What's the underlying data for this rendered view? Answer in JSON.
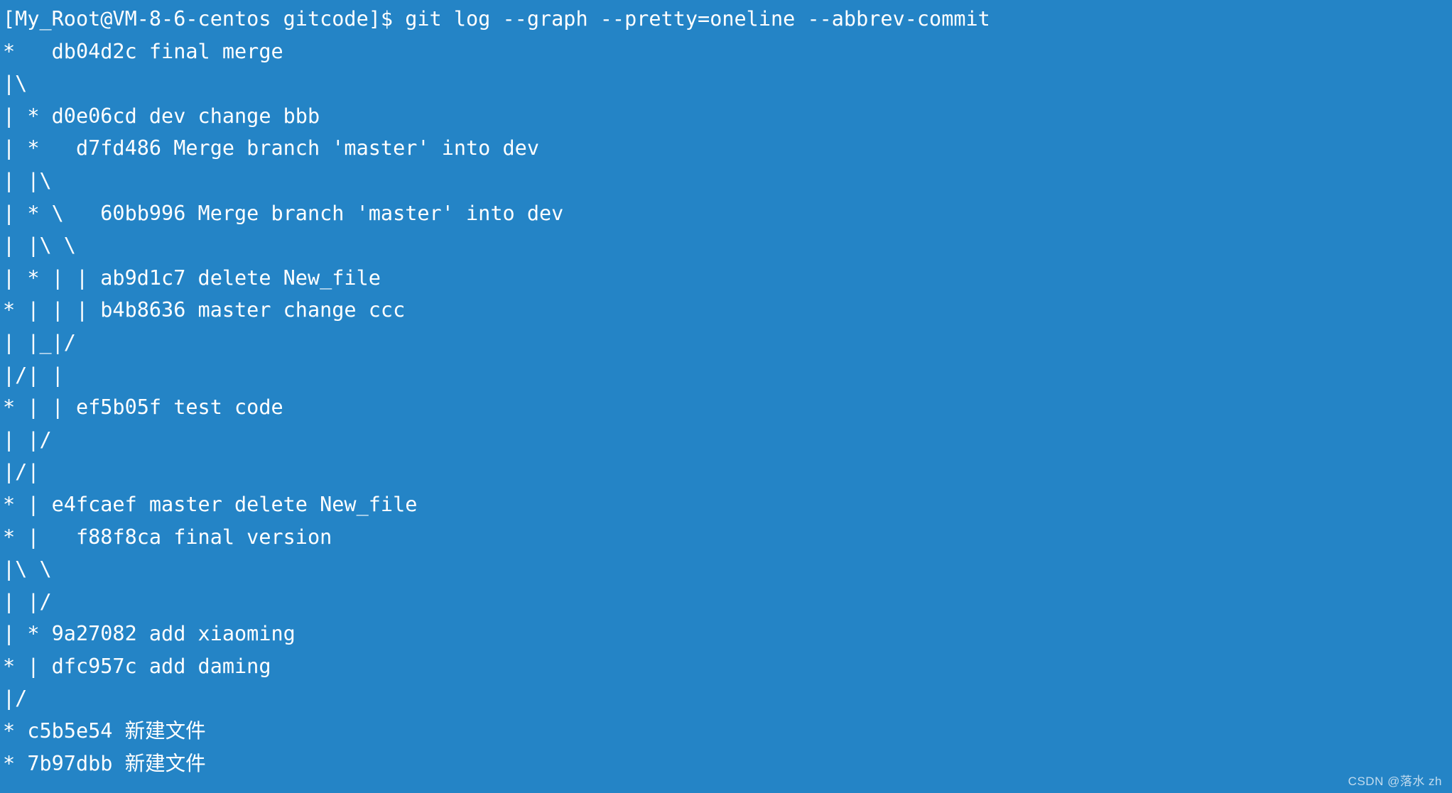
{
  "terminal": {
    "background_color": "#2484c6",
    "foreground_color": "#ffffff",
    "prompt": {
      "user": "My_Root",
      "host": "VM-8-6-centos",
      "cwd": "gitcode",
      "symbol": "$",
      "full": "[My_Root@VM-8-6-centos gitcode]$"
    },
    "command": "git log --graph --pretty=oneline --abbrev-commit",
    "lines": [
      "[My_Root@VM-8-6-centos gitcode]$ git log --graph --pretty=oneline --abbrev-commit",
      "*   db04d2c final merge",
      "|\\",
      "| * d0e06cd dev change bbb",
      "| *   d7fd486 Merge branch 'master' into dev",
      "| |\\",
      "| * \\   60bb996 Merge branch 'master' into dev",
      "| |\\ \\",
      "| * | | ab9d1c7 delete New_file",
      "* | | | b4b8636 master change ccc",
      "| |_|/",
      "|/| |",
      "* | | ef5b05f test code",
      "| |/",
      "|/|",
      "* | e4fcaef master delete New_file",
      "* |   f88f8ca final version",
      "|\\ \\",
      "| |/",
      "| * 9a27082 add xiaoming",
      "* | dfc957c add daming",
      "|/",
      "* c5b5e54 新建文件",
      "* 7b97dbb 新建文件"
    ],
    "commits": [
      {
        "hash": "db04d2c",
        "subject": "final merge",
        "graph": "*  "
      },
      {
        "hash": "d0e06cd",
        "subject": "dev change bbb",
        "graph": "| *"
      },
      {
        "hash": "d7fd486",
        "subject": "Merge branch 'master' into dev",
        "graph": "| *  "
      },
      {
        "hash": "60bb996",
        "subject": "Merge branch 'master' into dev",
        "graph": "| * \\  "
      },
      {
        "hash": "ab9d1c7",
        "subject": "delete New_file",
        "graph": "| * | |"
      },
      {
        "hash": "b4b8636",
        "subject": "master change ccc",
        "graph": "* | | |"
      },
      {
        "hash": "ef5b05f",
        "subject": "test code",
        "graph": "* | |"
      },
      {
        "hash": "e4fcaef",
        "subject": "master delete New_file",
        "graph": "* |"
      },
      {
        "hash": "f88f8ca",
        "subject": "final version",
        "graph": "* |  "
      },
      {
        "hash": "9a27082",
        "subject": "add xiaoming",
        "graph": "| *"
      },
      {
        "hash": "dfc957c",
        "subject": "add daming",
        "graph": "* |"
      },
      {
        "hash": "c5b5e54",
        "subject": "新建文件",
        "graph": "*"
      },
      {
        "hash": "7b97dbb",
        "subject": "新建文件",
        "graph": "*"
      }
    ]
  },
  "watermark": {
    "text": "CSDN @落水 zh"
  }
}
